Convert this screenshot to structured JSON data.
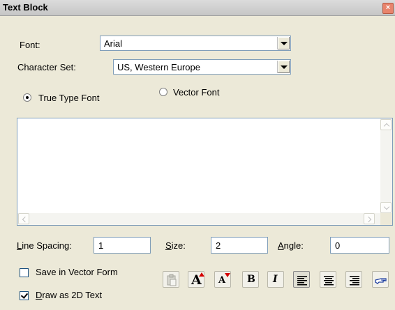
{
  "window": {
    "title": "Text Block",
    "close_glyph": "×"
  },
  "font": {
    "label": "Font:",
    "value": "Arial"
  },
  "charset": {
    "label": "Character Set:",
    "value": "US, Western Europe"
  },
  "radios": {
    "true_type": "True Type Font",
    "vector": "Vector Font",
    "selected": "true_type"
  },
  "text_area": {
    "value": ""
  },
  "line_spacing": {
    "label_u": "L",
    "label_rest": "ine Spacing:",
    "value": "1"
  },
  "size": {
    "label_u": "S",
    "label_rest": "ize:",
    "value": "2"
  },
  "angle": {
    "label_u": "A",
    "label_rest": "ngle:",
    "value": "0"
  },
  "save_vector": {
    "label": "Save in Vector Form",
    "checked": false
  },
  "draw_2d": {
    "label_u": "D",
    "label_rest": "raw as 2D Text",
    "checked": true
  },
  "toolbar": {
    "paste_icon": "paste-icon",
    "increase_font_glyph": "A",
    "decrease_font_glyph": "A",
    "bold_glyph": "B",
    "italic_glyph": "I",
    "align_left_icon": "align-left-icon",
    "align_center_icon": "align-center-icon",
    "align_right_icon": "align-right-icon",
    "pick_icon": "hand-pointer-icon"
  },
  "colors": {
    "accent_red": "#d40000",
    "field_border": "#7f9db9",
    "dialog_bg": "#ece9d8"
  }
}
